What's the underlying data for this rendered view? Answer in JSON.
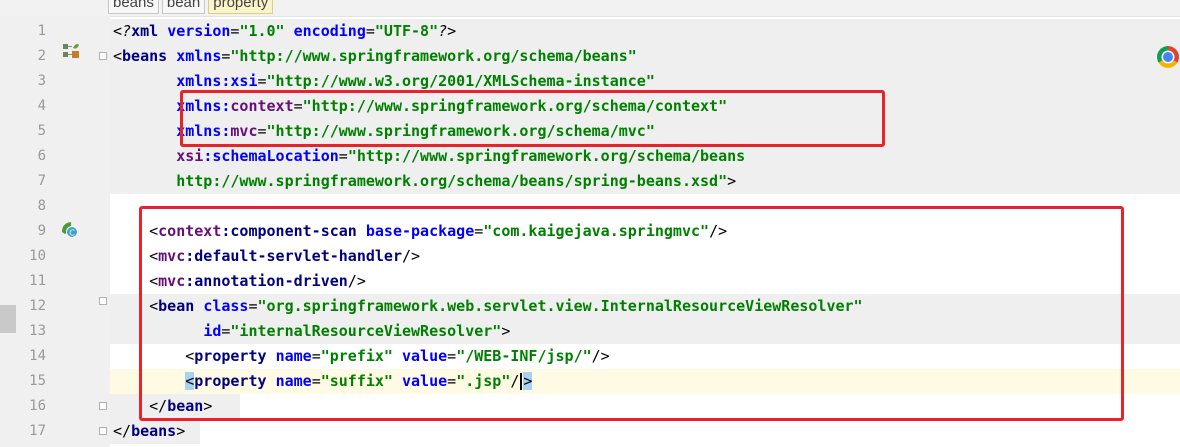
{
  "breadcrumbs": [
    "beans",
    "bean",
    "property"
  ],
  "lines": [
    {
      "num": "1",
      "segments": [
        {
          "text": "<?",
          "cls": "pi"
        },
        {
          "text": "xml ",
          "cls": "t"
        },
        {
          "text": "version",
          "cls": "a"
        },
        {
          "text": "=",
          "cls": "p"
        },
        {
          "text": "\"1.0\"",
          "cls": "s"
        },
        {
          "text": " ",
          "cls": "p"
        },
        {
          "text": "encoding",
          "cls": "a"
        },
        {
          "text": "=",
          "cls": "p"
        },
        {
          "text": "\"UTF-8\"",
          "cls": "s"
        },
        {
          "text": "?>",
          "cls": "pi"
        }
      ]
    },
    {
      "num": "2",
      "segments": [
        {
          "text": "<",
          "cls": "p"
        },
        {
          "text": "beans ",
          "cls": "t"
        },
        {
          "text": "xmlns",
          "cls": "a"
        },
        {
          "text": "=",
          "cls": "p"
        },
        {
          "text": "\"http://www.springframework.org/schema/beans\"",
          "cls": "s"
        }
      ]
    },
    {
      "num": "3",
      "segments": [
        {
          "text": "       ",
          "cls": "p"
        },
        {
          "text": "xmlns:xsi",
          "cls": "a"
        },
        {
          "text": "=",
          "cls": "p"
        },
        {
          "text": "\"http://www.w3.org/2001/XMLSchema-instance\"",
          "cls": "s"
        }
      ]
    },
    {
      "num": "4",
      "segments": [
        {
          "text": "       ",
          "cls": "p"
        },
        {
          "text": "xmlns:",
          "cls": "a"
        },
        {
          "text": "context",
          "cls": "n"
        },
        {
          "text": "=",
          "cls": "p"
        },
        {
          "text": "\"http://www.springframework.org/schema/context\"",
          "cls": "s"
        }
      ]
    },
    {
      "num": "5",
      "segments": [
        {
          "text": "       ",
          "cls": "p"
        },
        {
          "text": "xmlns:",
          "cls": "a"
        },
        {
          "text": "mvc",
          "cls": "n"
        },
        {
          "text": "=",
          "cls": "p"
        },
        {
          "text": "\"http://www.springframework.org/schema/mvc\"",
          "cls": "s"
        }
      ]
    },
    {
      "num": "6",
      "segments": [
        {
          "text": "       ",
          "cls": "p"
        },
        {
          "text": "xsi",
          "cls": "n"
        },
        {
          "text": ":schemaLocation",
          "cls": "a"
        },
        {
          "text": "=",
          "cls": "p"
        },
        {
          "text": "\"http://www.springframework.org/schema/beans",
          "cls": "s"
        }
      ]
    },
    {
      "num": "7",
      "segments": [
        {
          "text": "       ",
          "cls": "p"
        },
        {
          "text": "http://www.springframework.org/schema/beans/spring-beans.xsd\"",
          "cls": "s"
        },
        {
          "text": ">",
          "cls": "p"
        }
      ]
    },
    {
      "num": "8",
      "segments": []
    },
    {
      "num": "9",
      "segments": [
        {
          "text": "    <",
          "cls": "p"
        },
        {
          "text": "context",
          "cls": "n"
        },
        {
          "text": ":component-scan ",
          "cls": "t"
        },
        {
          "text": "base-package",
          "cls": "a"
        },
        {
          "text": "=",
          "cls": "p"
        },
        {
          "text": "\"com.kaigejava.springmvc\"",
          "cls": "s"
        },
        {
          "text": "/>",
          "cls": "p"
        }
      ]
    },
    {
      "num": "10",
      "segments": [
        {
          "text": "    <",
          "cls": "p"
        },
        {
          "text": "mvc",
          "cls": "n"
        },
        {
          "text": ":default-servlet-handler",
          "cls": "t"
        },
        {
          "text": "/>",
          "cls": "p"
        }
      ]
    },
    {
      "num": "11",
      "segments": [
        {
          "text": "    <",
          "cls": "p"
        },
        {
          "text": "mvc",
          "cls": "n"
        },
        {
          "text": ":annotation-driven",
          "cls": "t"
        },
        {
          "text": "/>",
          "cls": "p"
        }
      ]
    },
    {
      "num": "12",
      "segments": [
        {
          "text": "    <",
          "cls": "p"
        },
        {
          "text": "bean ",
          "cls": "t"
        },
        {
          "text": "class",
          "cls": "a"
        },
        {
          "text": "=",
          "cls": "p"
        },
        {
          "text": "\"org.springframework.web.servlet.view.InternalResourceViewResolver\"",
          "cls": "s"
        }
      ]
    },
    {
      "num": "13",
      "segments": [
        {
          "text": "          ",
          "cls": "p"
        },
        {
          "text": "id",
          "cls": "a"
        },
        {
          "text": "=",
          "cls": "p"
        },
        {
          "text": "\"internalResourceViewResolver\"",
          "cls": "s"
        },
        {
          "text": ">",
          "cls": "p"
        }
      ]
    },
    {
      "num": "14",
      "segments": [
        {
          "text": "        <",
          "cls": "p"
        },
        {
          "text": "property ",
          "cls": "t"
        },
        {
          "text": "name",
          "cls": "a"
        },
        {
          "text": "=",
          "cls": "p"
        },
        {
          "text": "\"prefix\"",
          "cls": "s"
        },
        {
          "text": " ",
          "cls": "p"
        },
        {
          "text": "value",
          "cls": "a"
        },
        {
          "text": "=",
          "cls": "p"
        },
        {
          "text": "\"/WEB-INF/jsp/\"",
          "cls": "s"
        },
        {
          "text": "/>",
          "cls": "p"
        }
      ]
    },
    {
      "num": "15",
      "segments": [
        {
          "text": "        ",
          "cls": "p"
        },
        {
          "text": "<",
          "cls": "bm"
        },
        {
          "text": "property ",
          "cls": "t"
        },
        {
          "text": "name",
          "cls": "a"
        },
        {
          "text": "=",
          "cls": "p"
        },
        {
          "text": "\"suffix\"",
          "cls": "s"
        },
        {
          "text": " ",
          "cls": "p"
        },
        {
          "text": "value",
          "cls": "a"
        },
        {
          "text": "=",
          "cls": "p"
        },
        {
          "text": "\".jsp\"",
          "cls": "s"
        },
        {
          "text": "/",
          "cls": "p"
        },
        {
          "text": "",
          "cls": "caret"
        },
        {
          "text": ">",
          "cls": "bm"
        }
      ]
    },
    {
      "num": "16",
      "segments": [
        {
          "text": "    </",
          "cls": "p"
        },
        {
          "text": "bean",
          "cls": "t"
        },
        {
          "text": ">",
          "cls": "p"
        }
      ]
    },
    {
      "num": "17",
      "segments": [
        {
          "text": "</",
          "cls": "p"
        },
        {
          "text": "beans",
          "cls": "t"
        },
        {
          "text": ">",
          "cls": "p"
        }
      ]
    }
  ]
}
